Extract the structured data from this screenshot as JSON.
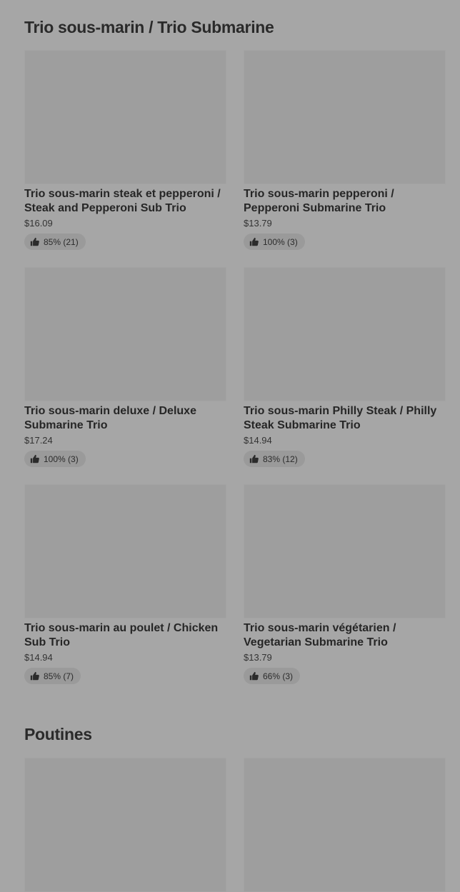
{
  "sections": [
    {
      "title": "Trio sous-marin / Trio Submarine",
      "items": [
        {
          "name": "Trio sous-marin steak et pepperoni / Steak and Pepperoni Sub Trio",
          "price": "$16.09",
          "rating": "85% (21)"
        },
        {
          "name": "Trio sous-marin pepperoni / Pepperoni Submarine Trio",
          "price": "$13.79",
          "rating": "100% (3)"
        },
        {
          "name": "Trio sous-marin deluxe / Deluxe Submarine Trio",
          "price": "$17.24",
          "rating": "100% (3)"
        },
        {
          "name": "Trio sous-marin Philly Steak / Philly Steak Submarine Trio",
          "price": "$14.94",
          "rating": "83% (12)"
        },
        {
          "name": "Trio sous-marin au poulet / Chicken Sub Trio",
          "price": "$14.94",
          "rating": "85% (7)"
        },
        {
          "name": "Trio sous-marin végétarien / Vegetarian Submarine Trio",
          "price": "$13.79",
          "rating": "66% (3)"
        }
      ]
    },
    {
      "title": "Poutines",
      "items": []
    }
  ],
  "icons": {
    "rating": "thumbs-up-icon"
  }
}
